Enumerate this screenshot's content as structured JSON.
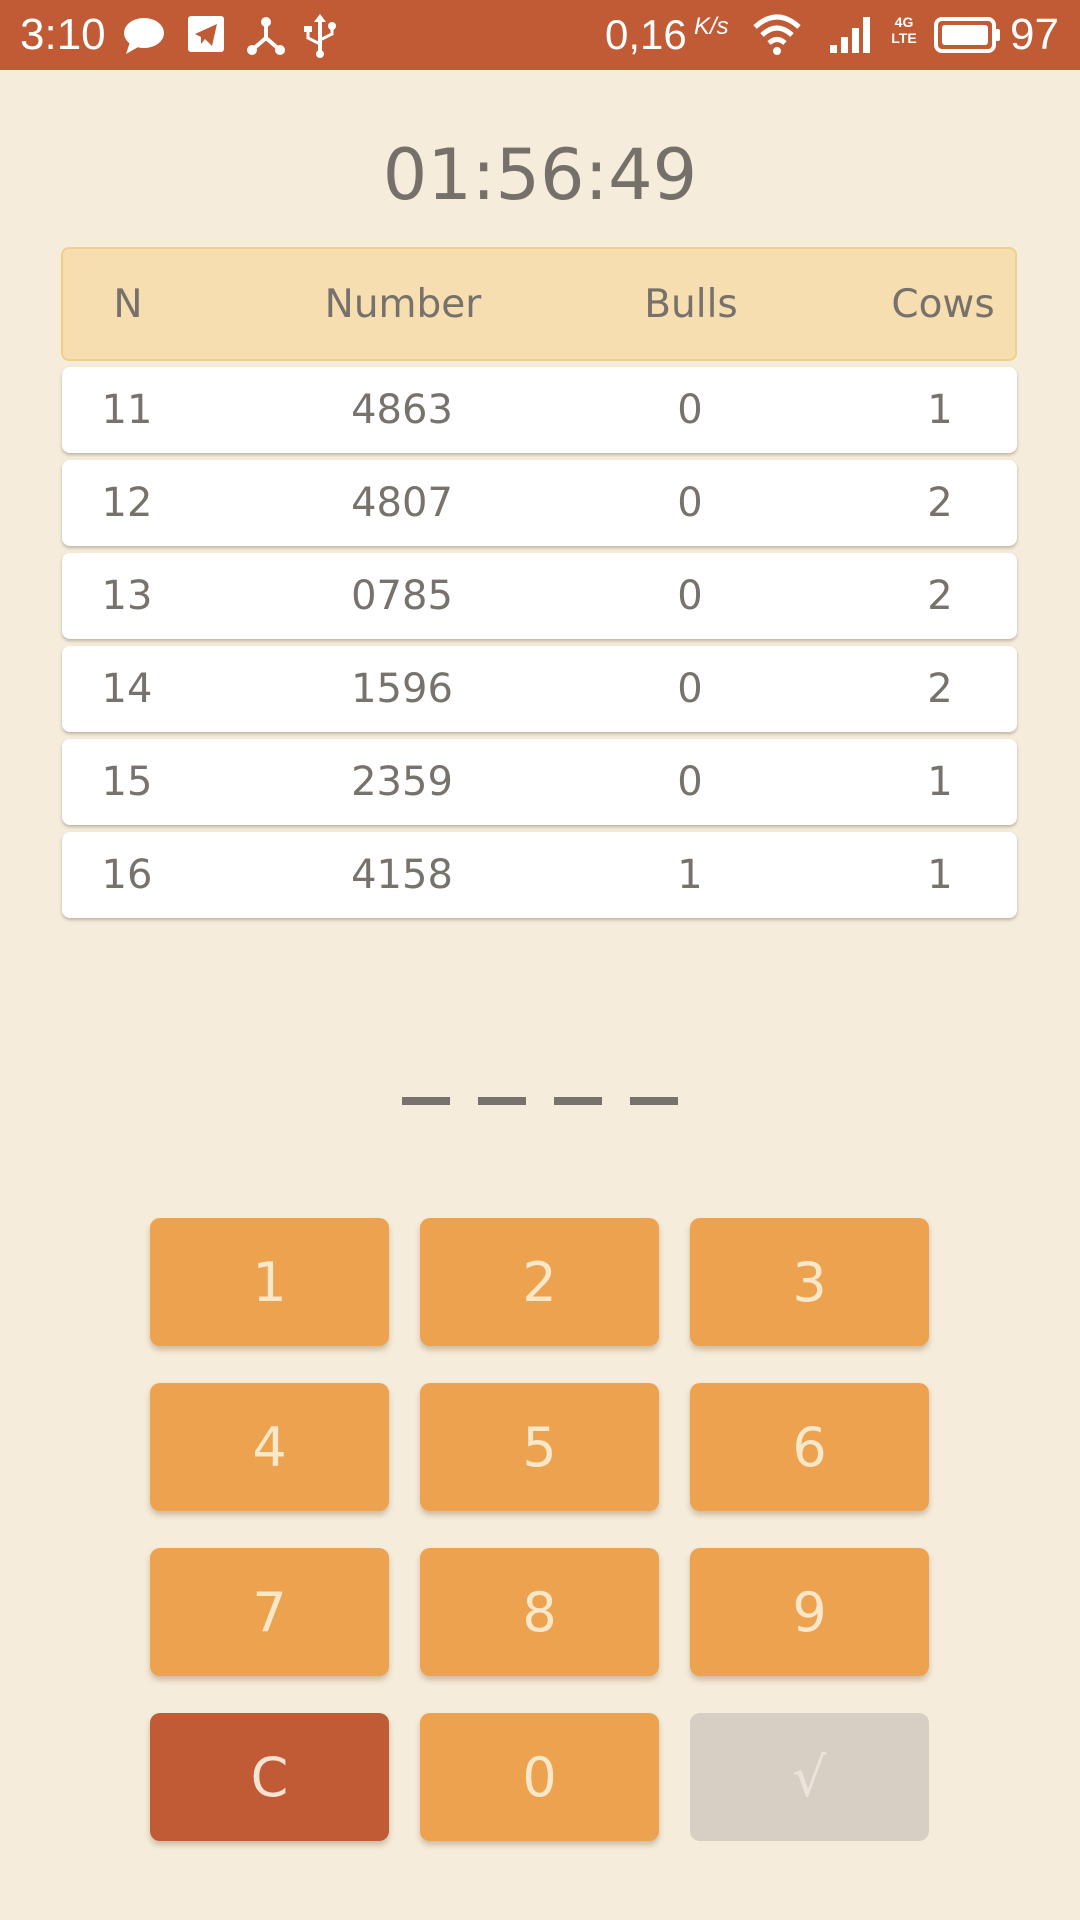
{
  "status_bar": {
    "time": "3:10",
    "speed_value": "0,16",
    "speed_unit": "K/s",
    "network_type_top": "4G",
    "network_type_bottom": "LTE",
    "battery_percent": "97",
    "icons": [
      "chat-bubble-icon",
      "telegram-icon",
      "share-network-icon",
      "usb-icon",
      "wifi-icon",
      "cell-signal-icon",
      "battery-icon"
    ]
  },
  "timer": "01:56:49",
  "table": {
    "headers": [
      "N",
      "Number",
      "Bulls",
      "Cows"
    ],
    "rows": [
      [
        "11",
        "4863",
        "0",
        "1"
      ],
      [
        "12",
        "4807",
        "0",
        "2"
      ],
      [
        "13",
        "0785",
        "0",
        "2"
      ],
      [
        "14",
        "1596",
        "0",
        "2"
      ],
      [
        "15",
        "2359",
        "0",
        "1"
      ],
      [
        "16",
        "4158",
        "1",
        "1"
      ]
    ]
  },
  "keypad": {
    "keys": [
      "1",
      "2",
      "3",
      "4",
      "5",
      "6",
      "7",
      "8",
      "9",
      "C",
      "0",
      "√"
    ]
  },
  "colors": {
    "accent": "#c05b36",
    "key": "#eca24f",
    "header": "#f6deb1",
    "background": "#f6ecdb",
    "disabled": "#d8cfc4"
  }
}
